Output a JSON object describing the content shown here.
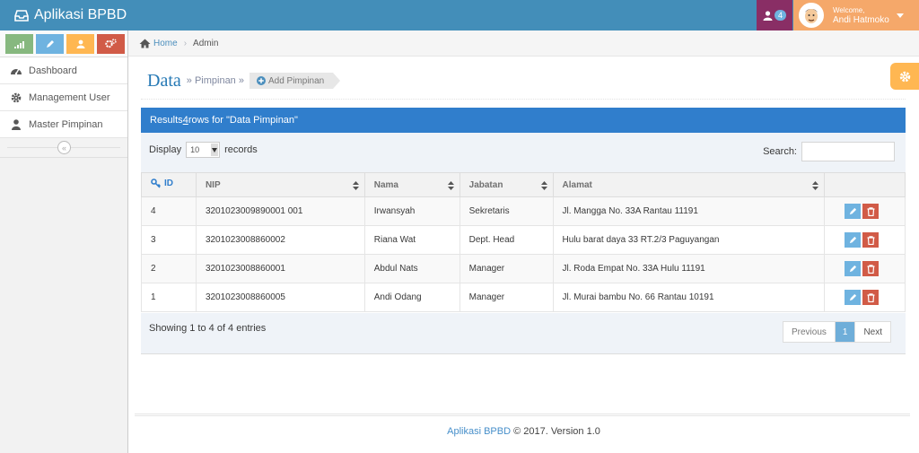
{
  "navbar": {
    "brand": "Aplikasi BPBD",
    "notif_count": "4",
    "welcome": "Welcome,",
    "user_name": "Andi Hatmoko"
  },
  "sidebar": {
    "shortcuts": [
      "signal-icon",
      "pencil-icon",
      "users-icon",
      "cogs-icon"
    ],
    "items": [
      {
        "label": "Dashboard",
        "icon": "dashboard-icon"
      },
      {
        "label": "Management User",
        "icon": "gear-icon"
      },
      {
        "label": "Master Pimpinan",
        "icon": "user-icon"
      }
    ],
    "collapse_symbol": "«"
  },
  "breadcrumb": {
    "home": "Home",
    "current": "Admin"
  },
  "page_header": {
    "title": "Data",
    "subtitle": "» Pimpinan »",
    "add_label": "Add Pimpinan"
  },
  "table_header": {
    "prefix": "Results ",
    "count": "4",
    "suffix": " rows for \"Data Pimpinan\""
  },
  "controls": {
    "display_label": "Display",
    "length_value": "10",
    "records_label": "records",
    "search_label": "Search:",
    "search_value": ""
  },
  "table": {
    "columns": [
      "ID",
      "NIP",
      "Nama",
      "Jabatan",
      "Alamat",
      ""
    ],
    "rows": [
      {
        "id": "4",
        "nip": "3201023009890001 001",
        "nama": "Irwansyah",
        "jabatan": "Sekretaris",
        "alamat": "Jl. Mangga No. 33A Rantau 11191"
      },
      {
        "id": "3",
        "nip": "3201023008860002",
        "nama": "Riana Wat",
        "jabatan": "Dept. Head",
        "alamat": "Hulu barat daya 33 RT.2/3 Paguyangan"
      },
      {
        "id": "2",
        "nip": "3201023008860001",
        "nama": "Abdul Nats",
        "jabatan": "Manager",
        "alamat": "Jl. Roda Empat No. 33A Hulu 11191"
      },
      {
        "id": "1",
        "nip": "3201023008860005",
        "nama": "Andi Odang",
        "jabatan": "Manager",
        "alamat": "Jl. Murai bambu No. 66 Rantau 10191"
      }
    ]
  },
  "pagination": {
    "info": "Showing 1 to 4 of 4 entries",
    "prev": "Previous",
    "current": "1",
    "next": "Next"
  },
  "footer": {
    "app": "Aplikasi BPBD",
    "text": " © 2017. Version 1.0"
  },
  "colors": {
    "navbar": "#438eb9",
    "table_head": "#307ecc",
    "edit": "#6fb3e0",
    "delete": "#d15b47",
    "settings": "#ffb752"
  }
}
